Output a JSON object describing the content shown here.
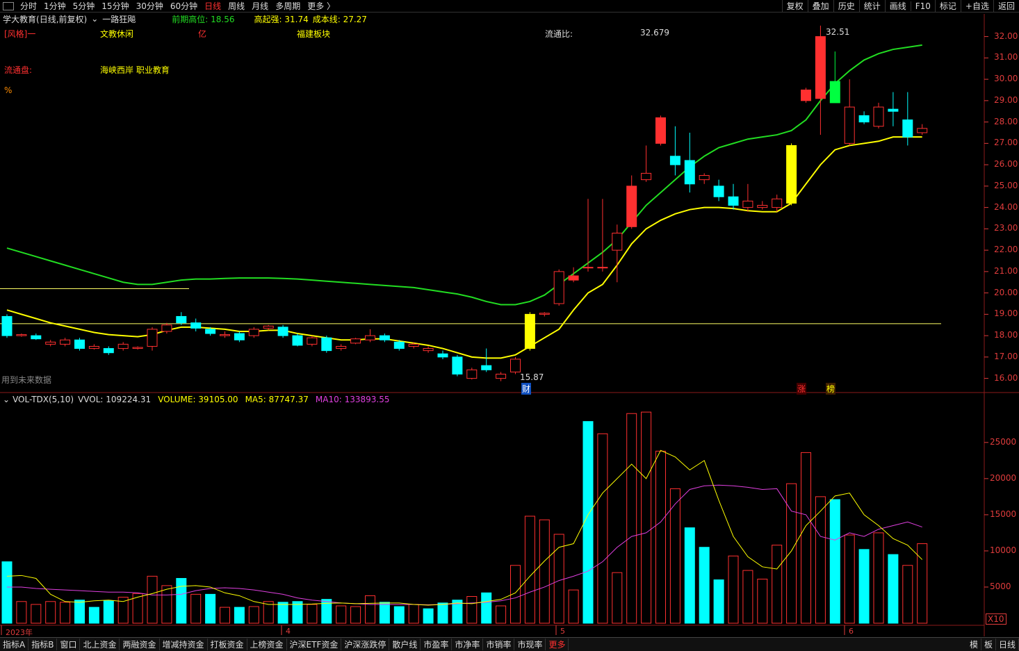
{
  "toolbar": {
    "periods": [
      "分时",
      "1分钟",
      "5分钟",
      "15分钟",
      "30分钟",
      "60分钟",
      "日线",
      "周线",
      "月线",
      "多周期",
      "更多 〉"
    ],
    "active_period": "日线",
    "right_buttons": [
      "复权",
      "叠加",
      "历史",
      "统计",
      "画线",
      "F10",
      "标记",
      "+自选",
      "返回"
    ]
  },
  "info": {
    "stock_name": "学大教育",
    "chart_mode": "(日线,前复权)",
    "indicator_name": "一路狂飚",
    "prev_high_label": "前期高位: 18.56",
    "strong_label": "高起强: 31.74",
    "cost_label": "成本线: 27.27"
  },
  "panel": {
    "style_label": "[风格]一",
    "industry": "文教休闲",
    "unit_yi": "亿",
    "region": "福建板块",
    "float_ratio_label": "流通比:",
    "float_ratio_value": "32.679",
    "float_cap_label": "流通盘:",
    "concepts": "海峡西岸 职业教育",
    "percent": "%",
    "future_data": "用到未来数据"
  },
  "price_axis": {
    "ticks": [
      "32.00",
      "31.00",
      "30.00",
      "29.00",
      "28.00",
      "27.00",
      "26.00",
      "25.00",
      "24.00",
      "23.00",
      "22.00",
      "21.00",
      "20.00",
      "19.00",
      "18.00",
      "17.00",
      "16.00"
    ]
  },
  "annotations": {
    "high_label": "32.51",
    "low_label": "15.87",
    "cai_marker": "财",
    "zhang_marker": "涨",
    "bang_marker": "榜"
  },
  "volume": {
    "title": "VOL-TDX(5,10)",
    "vvol": "VVOL: 109224.31",
    "volume": "VOLUME: 39105.00",
    "ma5": "MA5: 87747.37",
    "ma10": "MA10: 133893.55",
    "ticks": [
      "25000",
      "20000",
      "15000",
      "10000",
      "5000"
    ],
    "multiplier": "X10"
  },
  "dates": [
    "2023年",
    "4",
    "5",
    "6"
  ],
  "bottom": {
    "tabs": [
      "指标A",
      "指标B",
      "窗口",
      "北上资金",
      "两融资金",
      "增减持资金",
      "打板资金",
      "上榜资金",
      "沪深ETF资金",
      "沪深涨跌停",
      "散户线",
      "市盈率",
      "市净率",
      "市销率",
      "市现率",
      "更多"
    ],
    "right": [
      "模",
      "板",
      "日线"
    ]
  },
  "colors": {
    "up": "#ff3030",
    "down": "#00ffff",
    "yellow": "#ffff00",
    "green": "#22dd22",
    "magenta": "#e040e0"
  },
  "chart_data": {
    "type": "candlestick",
    "candles": [
      [
        18.9,
        18.0,
        19.0,
        17.9
      ],
      [
        18.0,
        18.05,
        18.1,
        17.95
      ],
      [
        18.0,
        17.85,
        18.1,
        17.8
      ],
      [
        17.6,
        17.7,
        17.8,
        17.5
      ],
      [
        17.6,
        17.8,
        17.9,
        17.5
      ],
      [
        17.8,
        17.4,
        17.9,
        17.3
      ],
      [
        17.4,
        17.5,
        17.6,
        17.35
      ],
      [
        17.4,
        17.2,
        17.5,
        17.1
      ],
      [
        17.4,
        17.6,
        17.7,
        17.3
      ],
      [
        17.4,
        17.45,
        17.5,
        17.35
      ],
      [
        17.5,
        18.3,
        18.4,
        17.3
      ],
      [
        18.2,
        18.5,
        18.6,
        18.1
      ],
      [
        18.9,
        18.6,
        19.1,
        18.5
      ],
      [
        18.6,
        18.35,
        18.8,
        18.2
      ],
      [
        18.3,
        18.1,
        18.4,
        18.0
      ],
      [
        18.0,
        18.05,
        18.2,
        17.9
      ],
      [
        18.1,
        17.8,
        18.2,
        17.7
      ],
      [
        18.0,
        18.3,
        18.4,
        17.9
      ],
      [
        18.35,
        18.45,
        18.5,
        18.25
      ],
      [
        18.4,
        18.0,
        18.5,
        17.9
      ],
      [
        18.0,
        17.55,
        18.1,
        17.5
      ],
      [
        17.6,
        17.9,
        18.0,
        17.5
      ],
      [
        17.9,
        17.3,
        18.0,
        17.2
      ],
      [
        17.4,
        17.5,
        17.6,
        17.3
      ],
      [
        17.65,
        17.85,
        17.9,
        17.6
      ],
      [
        17.8,
        18.0,
        18.3,
        17.7
      ],
      [
        18.0,
        17.8,
        18.1,
        17.7
      ],
      [
        17.7,
        17.4,
        17.8,
        17.3
      ],
      [
        17.5,
        17.6,
        17.7,
        17.4
      ],
      [
        17.3,
        17.4,
        17.5,
        17.2
      ],
      [
        17.15,
        17.0,
        17.3,
        16.9
      ],
      [
        17.0,
        16.2,
        17.1,
        16.1
      ],
      [
        16.0,
        16.4,
        16.5,
        15.95
      ],
      [
        16.6,
        16.4,
        17.4,
        16.3
      ],
      [
        16.0,
        16.2,
        16.3,
        15.87
      ],
      [
        16.3,
        16.9,
        17.0,
        16.2
      ],
      [
        17.4,
        19.0,
        19.1,
        17.3
      ],
      [
        19.0,
        19.05,
        19.1,
        18.9
      ],
      [
        19.5,
        21.0,
        21.1,
        19.4
      ],
      [
        20.6,
        20.8,
        21.2,
        20.5
      ],
      [
        21.2,
        21.2,
        24.4,
        21.0
      ],
      [
        21.2,
        21.2,
        24.4,
        21.0
      ],
      [
        22.0,
        22.8,
        23.2,
        20.5
      ],
      [
        23.1,
        25.0,
        25.5,
        23.0
      ],
      [
        25.3,
        25.6,
        26.9,
        25.2
      ],
      [
        27.0,
        28.2,
        28.3,
        26.9
      ],
      [
        26.4,
        26.0,
        27.8,
        25.5
      ],
      [
        26.2,
        25.1,
        27.5,
        24.7
      ],
      [
        25.3,
        25.5,
        25.6,
        25.1
      ],
      [
        25.0,
        24.5,
        25.3,
        24.3
      ],
      [
        24.5,
        24.1,
        25.1,
        23.9
      ],
      [
        24.0,
        24.3,
        25.1,
        23.8
      ],
      [
        24.0,
        24.1,
        24.3,
        23.9
      ],
      [
        24.0,
        24.4,
        24.6,
        23.8
      ],
      [
        24.2,
        26.9,
        27.0,
        24.1
      ],
      [
        29.0,
        29.5,
        29.6,
        28.9
      ],
      [
        29.1,
        32.0,
        32.51,
        27.4
      ],
      [
        29.9,
        28.9,
        31.3,
        28.9
      ],
      [
        27.0,
        28.7,
        30.0,
        26.9
      ],
      [
        28.3,
        28.0,
        28.5,
        27.9
      ],
      [
        27.8,
        28.7,
        28.9,
        27.7
      ],
      [
        28.6,
        28.5,
        29.4,
        27.8
      ],
      [
        28.1,
        27.3,
        29.4,
        26.9
      ],
      [
        27.5,
        27.7,
        27.9,
        27.4
      ]
    ],
    "price_range": [
      15.5,
      32.8
    ],
    "ma_yellow": [
      19.2,
      19.0,
      18.8,
      18.6,
      18.45,
      18.3,
      18.15,
      18.05,
      18.0,
      17.95,
      18.05,
      18.25,
      18.4,
      18.4,
      18.35,
      18.3,
      18.2,
      18.2,
      18.25,
      18.25,
      18.1,
      18.0,
      17.9,
      17.8,
      17.8,
      17.85,
      17.85,
      17.75,
      17.65,
      17.55,
      17.4,
      17.2,
      17.0,
      16.95,
      16.95,
      17.1,
      17.5,
      17.9,
      18.3,
      19.2,
      20.0,
      20.4,
      21.3,
      22.3,
      23.0,
      23.4,
      23.7,
      23.9,
      24.0,
      24.0,
      23.95,
      23.85,
      23.8,
      23.8,
      24.2,
      25.1,
      26.0,
      26.7,
      26.9,
      27.0,
      27.1,
      27.3,
      27.3,
      27.3
    ],
    "ma_green": [
      22.1,
      21.9,
      21.7,
      21.5,
      21.3,
      21.1,
      20.9,
      20.7,
      20.5,
      20.4,
      20.4,
      20.5,
      20.6,
      20.65,
      20.65,
      20.68,
      20.7,
      20.7,
      20.7,
      20.68,
      20.65,
      20.6,
      20.55,
      20.5,
      20.45,
      20.4,
      20.35,
      20.3,
      20.25,
      20.15,
      20.05,
      19.95,
      19.8,
      19.6,
      19.45,
      19.45,
      19.6,
      19.9,
      20.4,
      20.9,
      21.4,
      21.9,
      22.5,
      23.3,
      24.1,
      24.7,
      25.3,
      25.9,
      26.4,
      26.8,
      27.0,
      27.2,
      27.3,
      27.4,
      27.6,
      28.1,
      29.0,
      29.8,
      30.4,
      30.9,
      31.2,
      31.4,
      31.5,
      31.6
    ],
    "prev_high_line": 18.56,
    "vol_range": [
      0,
      29500
    ],
    "volumes": [
      8500,
      3000,
      2600,
      3000,
      2900,
      3200,
      2200,
      3100,
      3600,
      4100,
      6500,
      5200,
      6200,
      4000,
      4000,
      2200,
      2200,
      2300,
      3000,
      2900,
      3000,
      2600,
      3300,
      2400,
      2300,
      3800,
      2900,
      2300,
      2600,
      2000,
      2800,
      3200,
      3700,
      4200,
      2400,
      8000,
      14800,
      14300,
      12300,
      4600,
      27900,
      26200,
      7000,
      29000,
      29200,
      23800,
      18600,
      13200,
      10500,
      6000,
      9300,
      7300,
      6100,
      10800,
      19300,
      23600,
      17500,
      17100,
      12200,
      10200,
      12500,
      9500,
      8000,
      11000
    ],
    "vol_up": [
      0,
      1,
      1,
      1,
      1,
      0,
      0,
      0,
      1,
      1,
      1,
      1,
      0,
      1,
      0,
      1,
      0,
      1,
      1,
      0,
      0,
      1,
      0,
      1,
      1,
      1,
      0,
      0,
      1,
      0,
      0,
      0,
      1,
      0,
      1,
      1,
      1,
      1,
      1,
      1,
      0,
      1,
      1,
      1,
      1,
      1,
      1,
      0,
      0,
      0,
      1,
      1,
      1,
      1,
      1,
      1,
      1,
      0,
      1,
      0,
      1,
      0,
      1,
      1
    ],
    "vol_ma5": [
      6500,
      6600,
      6200,
      4000,
      3000,
      2900,
      3100,
      3200,
      3000,
      3600,
      4100,
      4700,
      5100,
      5200,
      5000,
      4200,
      3800,
      3000,
      2600,
      2600,
      2600,
      2650,
      2750,
      2800,
      2700,
      2750,
      2800,
      2800,
      2600,
      2500,
      2600,
      2800,
      2700,
      3000,
      3300,
      4200,
      6500,
      8600,
      10500,
      11000,
      15000,
      18000,
      20000,
      22000,
      20000,
      23900,
      23000,
      21200,
      22500,
      17000,
      12000,
      9200,
      7800,
      7500,
      10000,
      13500,
      15500,
      17600,
      18000,
      15000,
      13500,
      11700,
      10800,
      8800
    ],
    "vol_ma10": [
      5000,
      5000,
      4800,
      4700,
      4600,
      4500,
      4400,
      4300,
      4300,
      4200,
      3900,
      3900,
      4000,
      4500,
      4800,
      4900,
      4800,
      4600,
      4300,
      4000,
      3500,
      3200,
      3000,
      2800,
      2700,
      2600,
      2600,
      2600,
      2600,
      2550,
      2600,
      2700,
      2800,
      2900,
      3100,
      3500,
      4300,
      5000,
      5900,
      6500,
      7200,
      8500,
      10500,
      12000,
      12500,
      14000,
      16500,
      18500,
      19000,
      19100,
      19000,
      18800,
      18500,
      18600,
      15500,
      15000,
      12000,
      11500,
      12500,
      12000,
      13000,
      13500,
      14000,
      13300
    ]
  }
}
